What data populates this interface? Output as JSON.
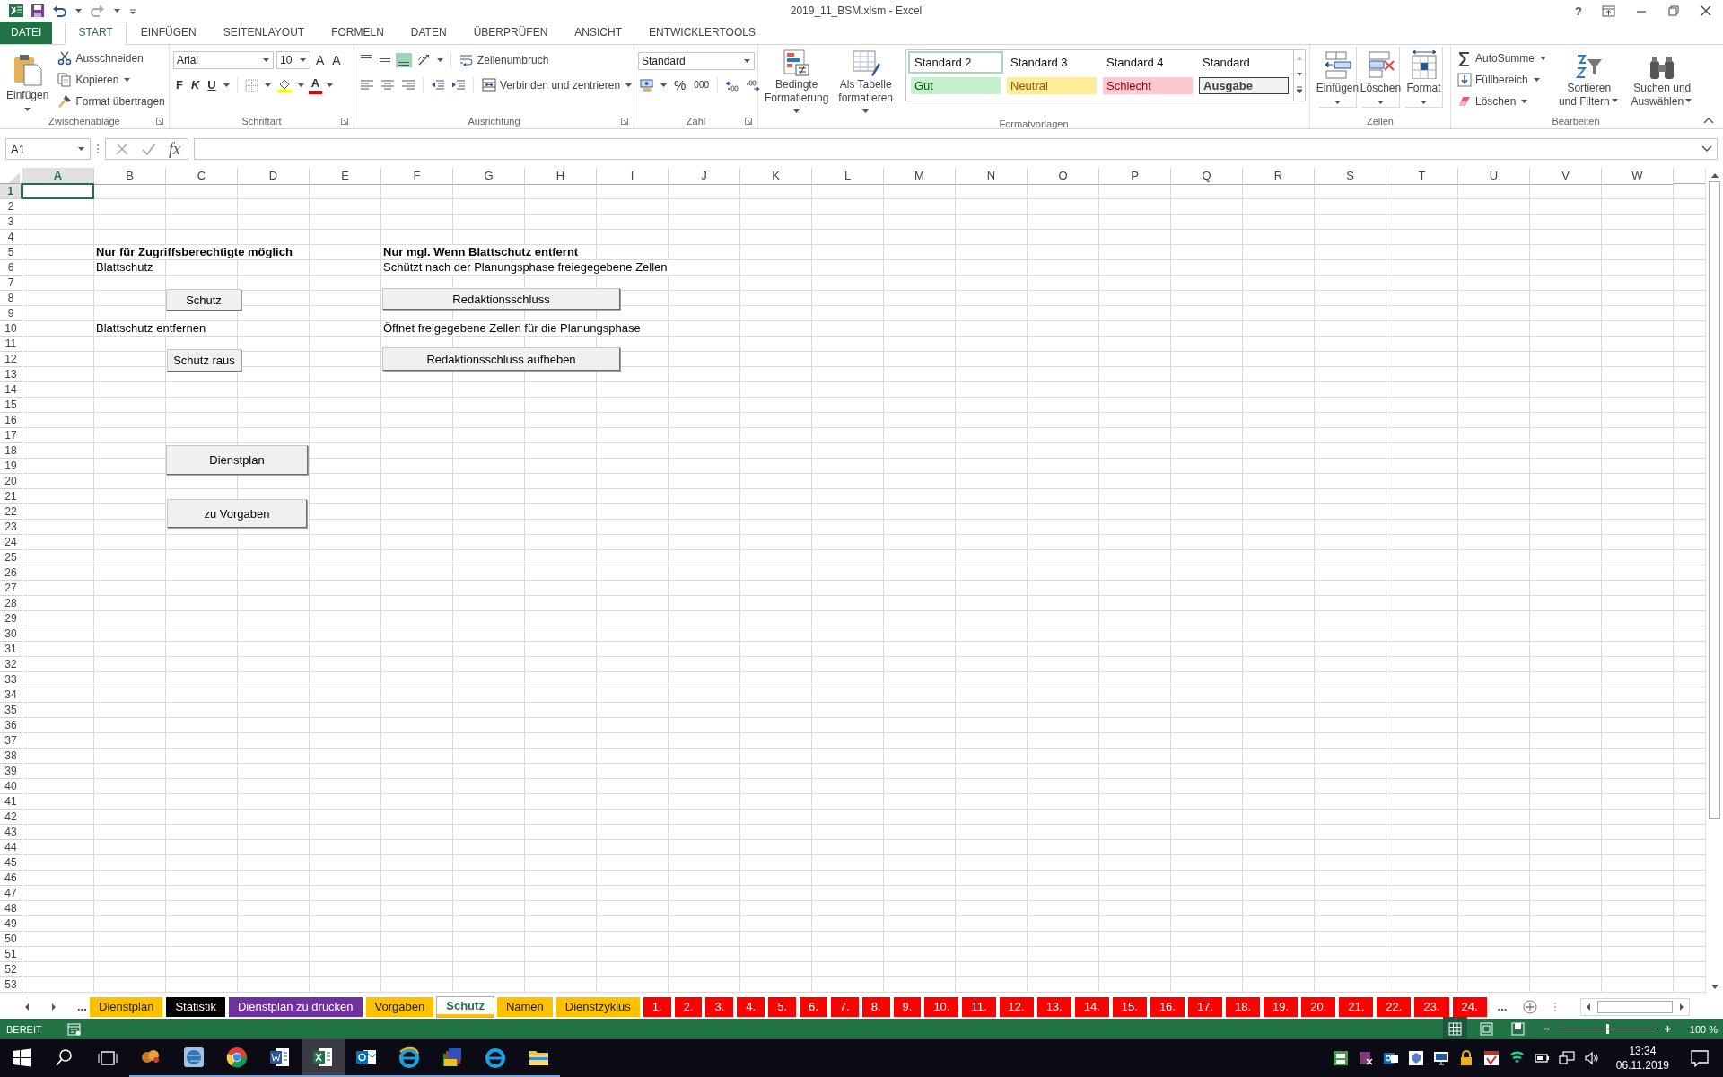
{
  "window": {
    "title": "2019_11_BSM.xlsm - Excel",
    "help": "?"
  },
  "ribbon_tabs": [
    {
      "label": "DATEI",
      "kind": "file",
      "selected": false
    },
    {
      "label": "START",
      "kind": "tab",
      "selected": true
    },
    {
      "label": "EINFÜGEN",
      "kind": "tab",
      "selected": false
    },
    {
      "label": "SEITENLAYOUT",
      "kind": "tab",
      "selected": false
    },
    {
      "label": "FORMELN",
      "kind": "tab",
      "selected": false
    },
    {
      "label": "DATEN",
      "kind": "tab",
      "selected": false
    },
    {
      "label": "ÜBERPRÜFEN",
      "kind": "tab",
      "selected": false
    },
    {
      "label": "ANSICHT",
      "kind": "tab",
      "selected": false
    },
    {
      "label": "ENTWICKLERTOOLS",
      "kind": "tab",
      "selected": false
    }
  ],
  "ribbon_groups": [
    {
      "kind": "clipboard",
      "label": "Zwischenablage",
      "paste": "Einfügen",
      "commands": [
        "Ausschneiden",
        "Kopieren",
        "Format übertragen"
      ]
    },
    {
      "kind": "font",
      "label": "Schriftart",
      "font": "Arial",
      "size": "10",
      "grow": "A",
      "shrink": "A",
      "bold": "F",
      "italic": "K",
      "underline": "U",
      "font_color": "A"
    },
    {
      "kind": "alignment",
      "label": "Ausrichtung",
      "vertical_align": [
        {
          "selected": false
        },
        {
          "selected": false
        },
        {
          "selected": true
        }
      ],
      "wrap": "Zeilenumbruch",
      "merge": "Verbinden und zentrieren"
    },
    {
      "kind": "number",
      "label": "Zahl",
      "format": "Standard",
      "percent": "%",
      "thousands": "000"
    },
    {
      "kind": "styles",
      "label": "Formatvorlagen",
      "conditional": "Bedingte Formatierung",
      "table": "Als Tabelle formatieren",
      "styles": [
        {
          "label": "Standard 2",
          "kind": "plain",
          "color": "#ffffff",
          "selected": true
        },
        {
          "label": "Standard 3",
          "kind": "plain",
          "color": "#ffffff",
          "selected": false
        },
        {
          "label": "Standard 4",
          "kind": "plain",
          "color": "#ffffff",
          "selected": false
        },
        {
          "label": "Standard",
          "kind": "plain",
          "color": "#ffffff",
          "selected": false
        },
        {
          "label": "Gut",
          "kind": "fill",
          "color": "#c6efce",
          "selected": false
        },
        {
          "label": "Neutral",
          "kind": "fill",
          "color": "#ffeb9c",
          "selected": false
        },
        {
          "label": "Schlecht",
          "kind": "fill",
          "color": "#ffc7ce",
          "selected": false
        },
        {
          "label": "Ausgabe",
          "kind": "output",
          "color": "#f2f2f2",
          "selected": false
        }
      ]
    },
    {
      "kind": "cells",
      "label": "Zellen",
      "commands": [
        "Einfügen",
        "Löschen",
        "Format"
      ]
    },
    {
      "kind": "editing",
      "label": "Bearbeiten",
      "commands": [
        "AutoSumme",
        "Füllbereich",
        "Löschen"
      ],
      "sort": "Sortieren und Filtern",
      "find": "Suchen und Auswählen"
    }
  ],
  "formula_bar": {
    "name_box": "A1",
    "function_button": "fx"
  },
  "sheet": {
    "columns": [
      {
        "label": "A",
        "selected": true
      },
      {
        "label": "B",
        "selected": false
      },
      {
        "label": "C",
        "selected": false
      },
      {
        "label": "D",
        "selected": false
      },
      {
        "label": "E",
        "selected": false
      },
      {
        "label": "F",
        "selected": false
      },
      {
        "label": "G",
        "selected": false
      },
      {
        "label": "H",
        "selected": false
      },
      {
        "label": "I",
        "selected": false
      },
      {
        "label": "J",
        "selected": false
      },
      {
        "label": "K",
        "selected": false
      },
      {
        "label": "L",
        "selected": false
      },
      {
        "label": "M",
        "selected": false
      },
      {
        "label": "N",
        "selected": false
      },
      {
        "label": "O",
        "selected": false
      },
      {
        "label": "P",
        "selected": false
      },
      {
        "label": "Q",
        "selected": false
      },
      {
        "label": "R",
        "selected": false
      },
      {
        "label": "S",
        "selected": false
      },
      {
        "label": "T",
        "selected": false
      },
      {
        "label": "U",
        "selected": false
      },
      {
        "label": "V",
        "selected": false
      },
      {
        "label": "W",
        "selected": false
      }
    ],
    "rows": [
      {
        "header": "1",
        "selected": true
      },
      {
        "header": "2",
        "selected": false
      },
      {
        "header": "3",
        "selected": false
      },
      {
        "header": "4",
        "selected": false
      },
      {
        "header": "5",
        "selected": false,
        "cells": {
          "B": {
            "text": "Nur für Zugriffsberechtigte möglich",
            "bold": true
          },
          "F": {
            "text": "Nur mgl. Wenn Blattschutz entfernt",
            "bold": true
          }
        }
      },
      {
        "header": "6",
        "selected": false,
        "cells": {
          "B": {
            "text": "Blattschutz",
            "bold": false
          },
          "F": {
            "text": "Schützt nach der Planungsphase freiegegebene Zellen",
            "bold": false
          }
        }
      },
      {
        "header": "7",
        "selected": false
      },
      {
        "header": "8",
        "selected": false
      },
      {
        "header": "9",
        "selected": false
      },
      {
        "header": "10",
        "selected": false,
        "cells": {
          "B": {
            "text": "Blattschutz entfernen",
            "bold": false
          },
          "F": {
            "text": "Öffnet freigegebene Zellen für die Planungsphase",
            "bold": false
          }
        }
      },
      {
        "header": "11",
        "selected": false
      },
      {
        "header": "12",
        "selected": false
      },
      {
        "header": "13",
        "selected": false
      },
      {
        "header": "14",
        "selected": false
      },
      {
        "header": "15",
        "selected": false
      },
      {
        "header": "16",
        "selected": false
      },
      {
        "header": "17",
        "selected": false
      },
      {
        "header": "18",
        "selected": false
      },
      {
        "header": "19",
        "selected": false
      },
      {
        "header": "20",
        "selected": false
      },
      {
        "header": "21",
        "selected": false
      },
      {
        "header": "22",
        "selected": false
      },
      {
        "header": "23",
        "selected": false
      },
      {
        "header": "24",
        "selected": false
      },
      {
        "header": "25",
        "selected": false
      },
      {
        "header": "26",
        "selected": false
      },
      {
        "header": "27",
        "selected": false
      },
      {
        "header": "28",
        "selected": false
      },
      {
        "header": "29",
        "selected": false
      },
      {
        "header": "30",
        "selected": false
      },
      {
        "header": "31",
        "selected": false
      },
      {
        "header": "32",
        "selected": false
      },
      {
        "header": "33",
        "selected": false
      },
      {
        "header": "34",
        "selected": false
      },
      {
        "header": "35",
        "selected": false
      },
      {
        "header": "36",
        "selected": false
      },
      {
        "header": "37",
        "selected": false
      },
      {
        "header": "38",
        "selected": false
      },
      {
        "header": "39",
        "selected": false
      },
      {
        "header": "40",
        "selected": false
      },
      {
        "header": "41",
        "selected": false
      },
      {
        "header": "42",
        "selected": false
      },
      {
        "header": "43",
        "selected": false
      },
      {
        "header": "44",
        "selected": false
      },
      {
        "header": "45",
        "selected": false
      },
      {
        "header": "46",
        "selected": false
      },
      {
        "header": "47",
        "selected": false
      },
      {
        "header": "48",
        "selected": false
      },
      {
        "header": "49",
        "selected": false
      },
      {
        "header": "50",
        "selected": false
      },
      {
        "header": "51",
        "selected": false
      },
      {
        "header": "52",
        "selected": false
      },
      {
        "header": "53",
        "selected": false
      }
    ],
    "buttons": [
      "Schutz",
      "Schutz raus",
      "Redaktionsschluss",
      "Redaktionsschluss aufheben",
      "Dienstplan",
      "zu Vorgaben"
    ]
  },
  "sheet_tabs": {
    "more_left": "...",
    "more_right": "...",
    "tabs": [
      {
        "label": "Dienstplan",
        "color": "#ffc000",
        "selected": false
      },
      {
        "label": "Statistik",
        "color": "#000000",
        "selected": false
      },
      {
        "label": "Dienstplan zu drucken",
        "color": "#7030a0",
        "selected": false
      },
      {
        "label": "Vorgaben",
        "color": "#ffc000",
        "selected": false
      },
      {
        "label": "Schutz",
        "color": "#ffc000",
        "selected": true
      },
      {
        "label": "Namen",
        "color": "#ffc000",
        "selected": false
      },
      {
        "label": "Dienstzyklus",
        "color": "#ffc000",
        "selected": false
      },
      {
        "label": "1.",
        "color": "#ff0000",
        "selected": false
      },
      {
        "label": "2.",
        "color": "#ff0000",
        "selected": false
      },
      {
        "label": "3.",
        "color": "#ff0000",
        "selected": false
      },
      {
        "label": "4.",
        "color": "#ff0000",
        "selected": false
      },
      {
        "label": "5.",
        "color": "#ff0000",
        "selected": false
      },
      {
        "label": "6.",
        "color": "#ff0000",
        "selected": false
      },
      {
        "label": "7.",
        "color": "#ff0000",
        "selected": false
      },
      {
        "label": "8.",
        "color": "#ff0000",
        "selected": false
      },
      {
        "label": "9.",
        "color": "#ff0000",
        "selected": false
      },
      {
        "label": "10.",
        "color": "#ff0000",
        "selected": false
      },
      {
        "label": "11.",
        "color": "#ff0000",
        "selected": false
      },
      {
        "label": "12.",
        "color": "#ff0000",
        "selected": false
      },
      {
        "label": "13.",
        "color": "#ff0000",
        "selected": false
      },
      {
        "label": "14.",
        "color": "#ff0000",
        "selected": false
      },
      {
        "label": "15.",
        "color": "#ff0000",
        "selected": false
      },
      {
        "label": "16.",
        "color": "#ff0000",
        "selected": false
      },
      {
        "label": "17.",
        "color": "#ff0000",
        "selected": false
      },
      {
        "label": "18.",
        "color": "#ff0000",
        "selected": false
      },
      {
        "label": "19.",
        "color": "#ff0000",
        "selected": false
      },
      {
        "label": "20.",
        "color": "#ff0000",
        "selected": false
      },
      {
        "label": "21.",
        "color": "#ff0000",
        "selected": false
      },
      {
        "label": "22.",
        "color": "#ff0000",
        "selected": false
      },
      {
        "label": "23.",
        "color": "#ff0000",
        "selected": false
      },
      {
        "label": "24.",
        "color": "#ff0000",
        "selected": false
      }
    ]
  },
  "status_bar": {
    "status": "BEREIT",
    "zoom_slider": {
      "level": 0.5
    },
    "zoom": "100 %"
  },
  "taskbar": {
    "time": "13:34",
    "date": "06.11.2019"
  }
}
